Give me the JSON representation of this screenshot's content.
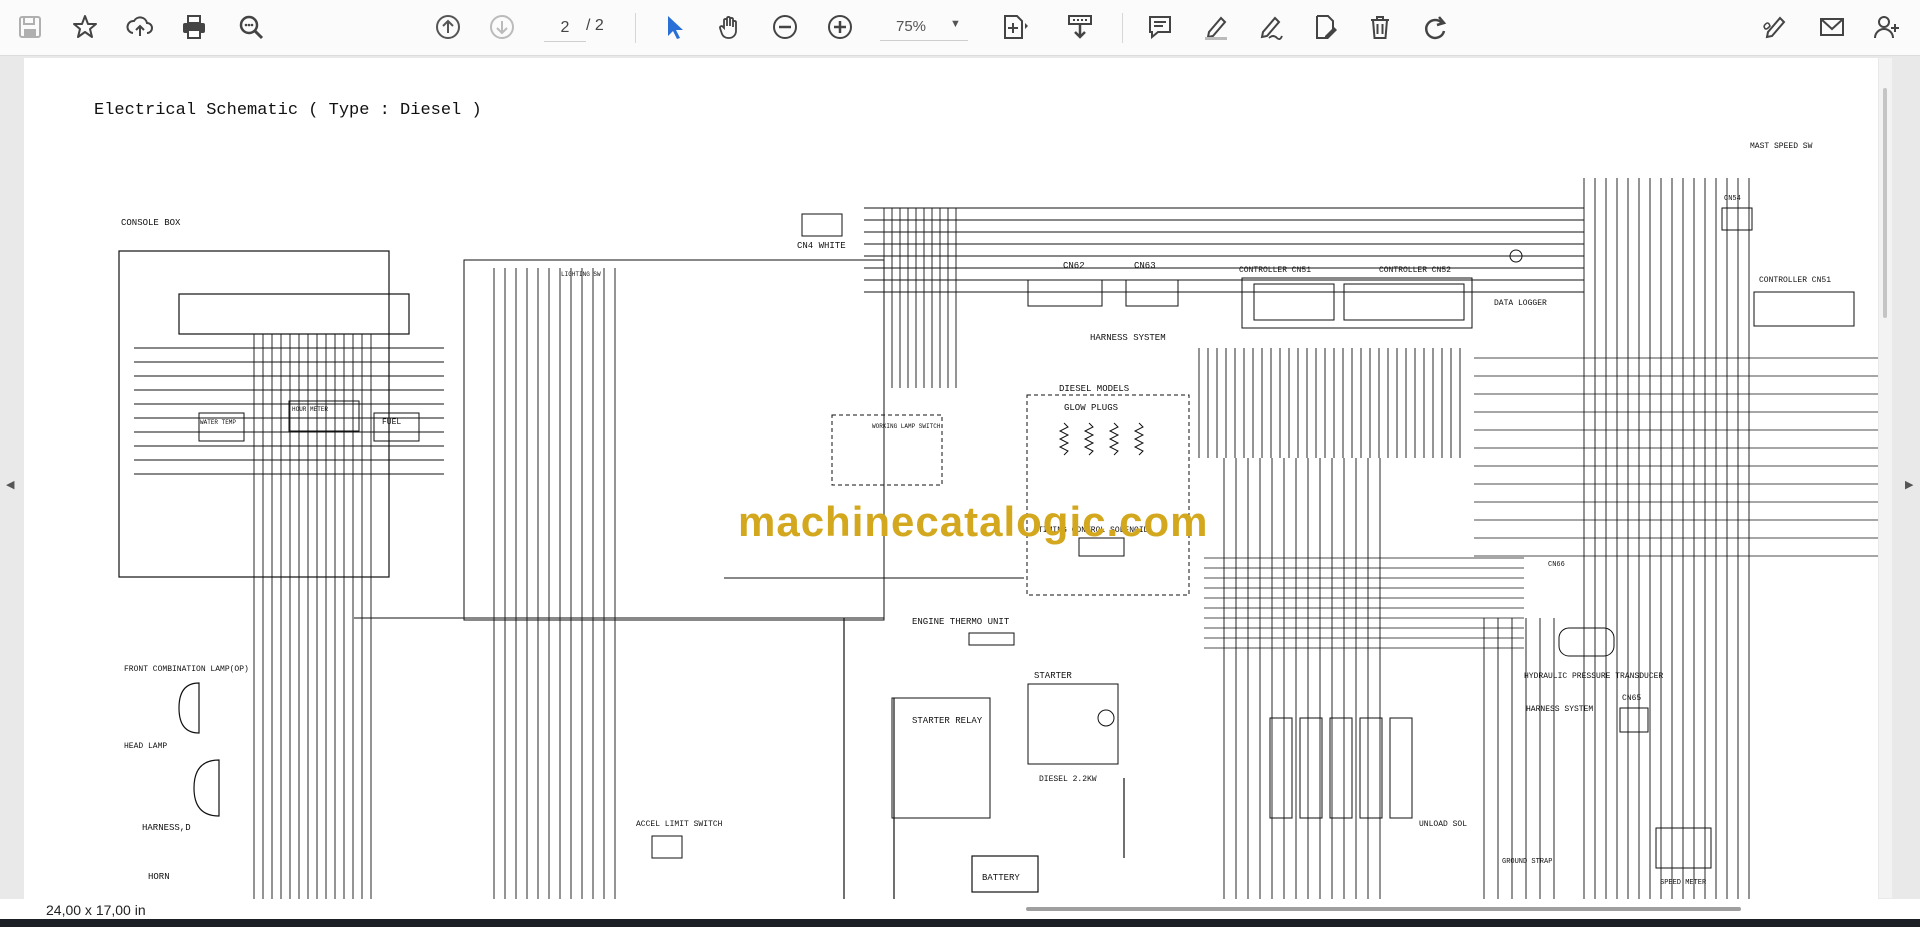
{
  "toolbar": {
    "page_current": "2",
    "page_total": "/ 2",
    "zoom": "75%",
    "icons": [
      "save-icon",
      "star-icon",
      "cloud-upload-icon",
      "print-icon",
      "zoom-search-icon",
      "page-up-icon",
      "page-down-icon",
      "select-cursor-icon",
      "hand-icon",
      "zoom-out-icon",
      "zoom-in-icon",
      "page-fit-icon",
      "scroll-mode-icon",
      "comment-icon",
      "highlight-pen-icon",
      "draw-icon",
      "stamp-icon",
      "delete-icon",
      "redo-icon",
      "sign-icon",
      "mail-icon",
      "add-user-icon"
    ]
  },
  "document": {
    "title": "Electrical Schematic ( Type : Diesel )",
    "labels": {
      "console_box": "CONSOLE BOX",
      "cn4_white": "CN4 WHITE",
      "cn62": "CN62",
      "cn63": "CN63",
      "controller_cn51": "CONTROLLER CN51",
      "controller_cn52": "CONTROLLER CN52",
      "controller_cn51_right": "CONTROLLER CN51",
      "data_logger": "DATA LOGGER",
      "mast_speed_sw": "MAST SPEED SW",
      "harness_system": "HARNESS SYSTEM",
      "diesel_models": "DIESEL MODELS",
      "glow_plugs": "GLOW PLUGS",
      "timing_control_solenoid": "TIMING CONTROL SOLENOID",
      "engine_thermo_unit": "ENGINE THERMO UNIT",
      "starter": "STARTER",
      "starter_relay": "STARTER RELAY",
      "diesel_kw": "DIESEL 2.2KW",
      "battery": "BATTERY",
      "front_combination_lamp": "FRONT COMBINATION LAMP(OP)",
      "head_lamp": "HEAD LAMP",
      "harness_d": "HARNESS,D",
      "horn": "HORN",
      "accel_limit_switch": "ACCEL LIMIT SWITCH",
      "unload_sol": "UNLOAD SOL",
      "ground_strap": "GROUND STRAP",
      "speed_meter": "SPEED METER",
      "hydraulic_pressure_transducer": "HYDRAULIC PRESSURE TRANSDUCER",
      "harness_system_right": "HARNESS SYSTEM",
      "cn65": "CN65",
      "cn54": "CN54",
      "cn66": "CN66",
      "water_temp": "WATER TEMP",
      "fuel": "FUEL",
      "hour_meter": "HOUR METER",
      "lighting_sw": "LIGHTING SW",
      "working_lamp_switch": "WORKING LAMP SWITCH"
    },
    "watermark": "machinecatalogic.com"
  },
  "status": {
    "page_size": "24,00 x 17,00 in"
  }
}
